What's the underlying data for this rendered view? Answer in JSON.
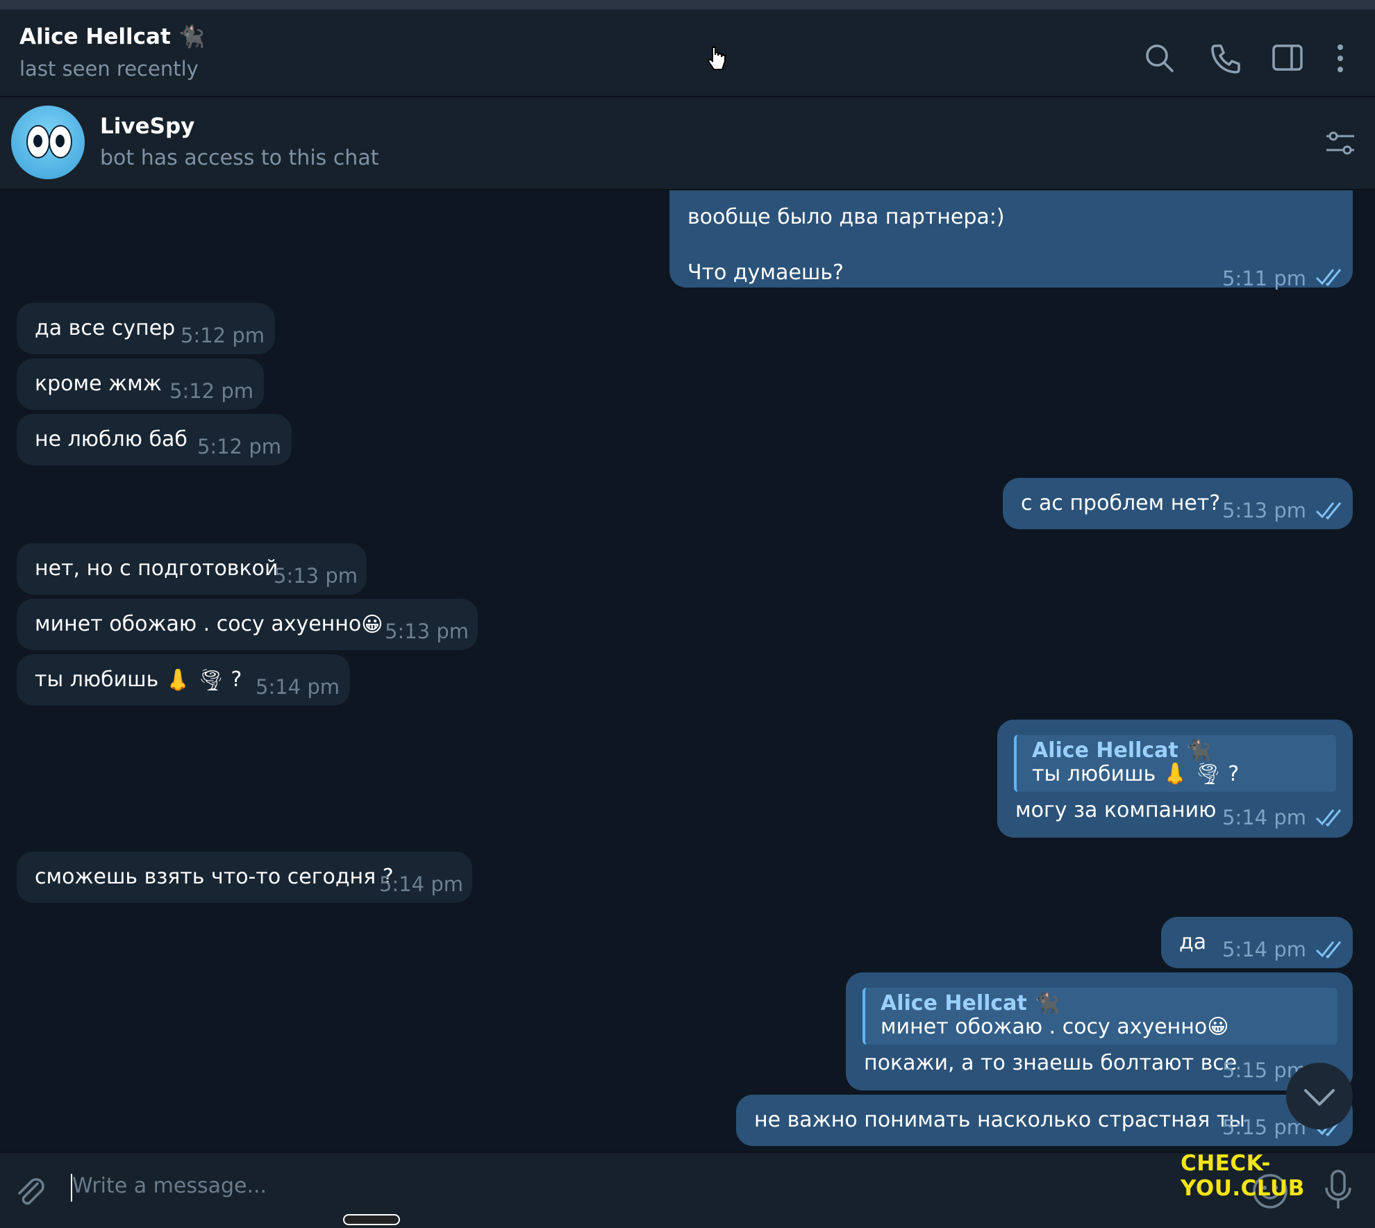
{
  "header": {
    "title": "Alice Hellcat 🐈‍⬛",
    "status": "last seen recently",
    "search_icon": "search-icon",
    "call_icon": "phone-icon",
    "sidebar_icon": "sidebar-toggle-icon",
    "menu_icon": "more-vertical-icon"
  },
  "pinned": {
    "name": "LiveSpy",
    "subtitle": "bot has access to this chat",
    "settings_icon": "filter-settings-icon"
  },
  "messages": [
    {
      "dir": "out",
      "text_lines": [
        "вообще было два партнера:)",
        "",
        "Что думаешь?"
      ],
      "time": "5:11 pm"
    },
    {
      "dir": "in",
      "text": "да все супер",
      "time": "5:12 pm"
    },
    {
      "dir": "in",
      "text": "кроме жмж",
      "time": "5:12 pm"
    },
    {
      "dir": "in",
      "text": "не люблю баб",
      "time": "5:12 pm"
    },
    {
      "dir": "out",
      "text": "с ас проблем нет?",
      "time": "5:13 pm"
    },
    {
      "dir": "in",
      "text": "нет, но с подготовкой",
      "time": "5:13 pm"
    },
    {
      "dir": "in",
      "text": "минет обожаю . сосу ахуенно",
      "emoji": "😀",
      "time": "5:13 pm"
    },
    {
      "dir": "in",
      "text": "ты любишь",
      "emoji": "👃 🌪",
      "text_after": " ?",
      "time": "5:14 pm"
    },
    {
      "dir": "out",
      "reply_to": {
        "name": "Alice Hellcat 🐈‍⬛",
        "text": "ты любишь 👃 🌪 ?"
      },
      "text": "могу за компанию",
      "time": "5:14 pm"
    },
    {
      "dir": "in",
      "text": "сможешь взять что-то сегодня ?",
      "time": "5:14 pm"
    },
    {
      "dir": "out",
      "text": "да",
      "time": "5:14 pm"
    },
    {
      "dir": "out",
      "reply_to": {
        "name": "Alice Hellcat 🐈‍⬛",
        "text": "минет обожаю . сосу ахуенно😀"
      },
      "text": "покажи, а то знаешь болтают все",
      "time": "5:15 pm"
    },
    {
      "dir": "out",
      "text": "не важно понимать насколько страстная ты",
      "time": "5:15 pm"
    }
  ],
  "composer": {
    "placeholder": "Write a message...",
    "attach_icon": "paperclip-icon",
    "emoji_icon": "smiley-icon",
    "mic_icon": "microphone-icon"
  },
  "watermark": "CHECK-YOU.CLUB"
}
